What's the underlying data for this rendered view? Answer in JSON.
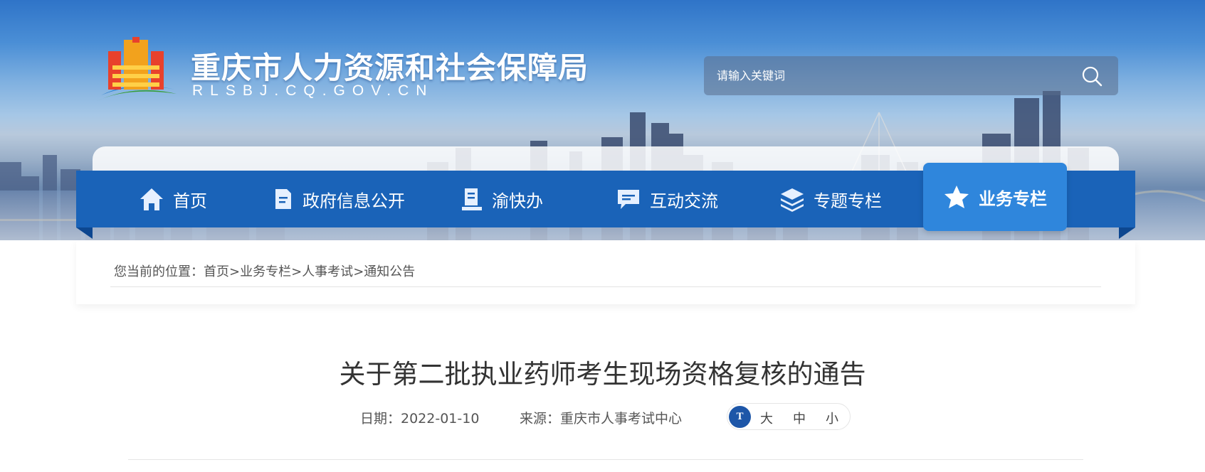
{
  "header": {
    "site_title": "重庆市人力资源和社会保障局",
    "site_domain": "RLSBJ.CQ.GOV.CN",
    "logo_icon": "government-building-logo",
    "search": {
      "placeholder": "请输入关键词",
      "icon": "search-icon"
    }
  },
  "nav": {
    "items": [
      {
        "label": "首页",
        "icon": "home-icon"
      },
      {
        "label": "政府信息公开",
        "icon": "document-icon"
      },
      {
        "label": "渝快办",
        "icon": "service-book-icon"
      },
      {
        "label": "互动交流",
        "icon": "chat-icon"
      },
      {
        "label": "专题专栏",
        "icon": "layers-icon"
      },
      {
        "label": "业务专栏",
        "icon": "star-icon",
        "active": true
      }
    ]
  },
  "breadcrumb": {
    "prefix": "您当前的位置：",
    "items": [
      "首页",
      "业务专栏",
      "人事考试",
      "通知公告"
    ],
    "separator": ">"
  },
  "article": {
    "title": "关于第二批执业药师考生现场资格复核的通告",
    "date_label": "日期：2022-01-10",
    "source_label": "来源：重庆市人事考试中心",
    "font_size": {
      "icon": "font-size-icon",
      "icon_text": "T",
      "large": "大",
      "medium": "中",
      "small": "小"
    }
  },
  "colors": {
    "nav_bg": "#1a63b8",
    "nav_active": "#2f86dc",
    "font_icon_bg": "#1d56a8"
  }
}
